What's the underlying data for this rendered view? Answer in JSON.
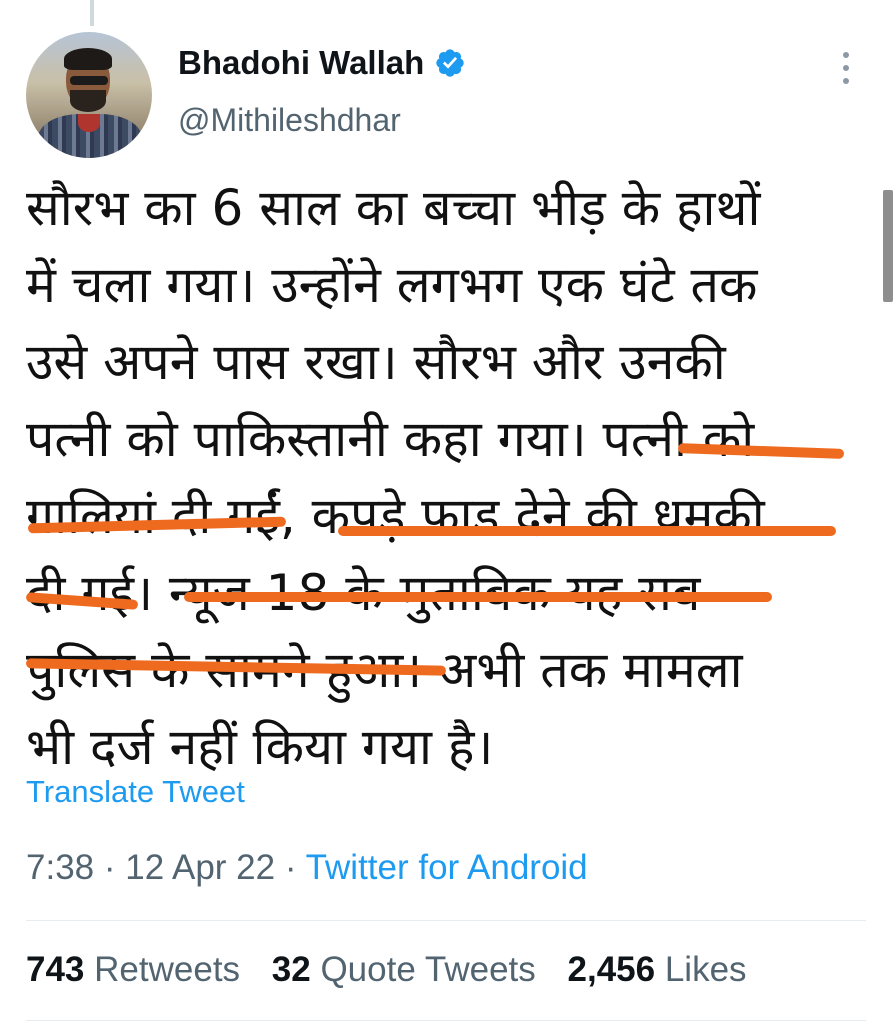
{
  "author": {
    "display_name": "Bhadohi Wallah",
    "handle": "@Mithileshdhar",
    "verified": true,
    "avatar_icon": "profile-photo"
  },
  "tweet": {
    "lines": [
      "सौरभ का 6 साल का बच्चा भीड़ के हाथों",
      "में चला गया। उन्होंने लगभग एक घंटे तक",
      "उसे अपने पास रखा। सौरभ और उनकी",
      "पत्नी को पाकिस्तानी कहा गया। पत्नी को",
      "गालियां दी गईं, कपड़े फाड देने की धमकी",
      "दी गई। न्यूज 18 के मुताबिक यह सब",
      "पुलिस के सामने हुआ। अभी तक मामला",
      "भी दर्ज नहीं किया गया है।"
    ],
    "translate_label": "Translate Tweet",
    "time": "7:38",
    "date": "12 Apr 22",
    "separator": "·",
    "source": "Twitter for Android"
  },
  "stats": {
    "retweets_count": "743",
    "retweets_label": "Retweets",
    "quotes_count": "32",
    "quotes_label": "Quote Tweets",
    "likes_count": "2,456",
    "likes_label": "Likes"
  },
  "colors": {
    "accent": "#1d9bf0",
    "highlight_underline": "#ee6a1f",
    "secondary_text": "#536471"
  }
}
